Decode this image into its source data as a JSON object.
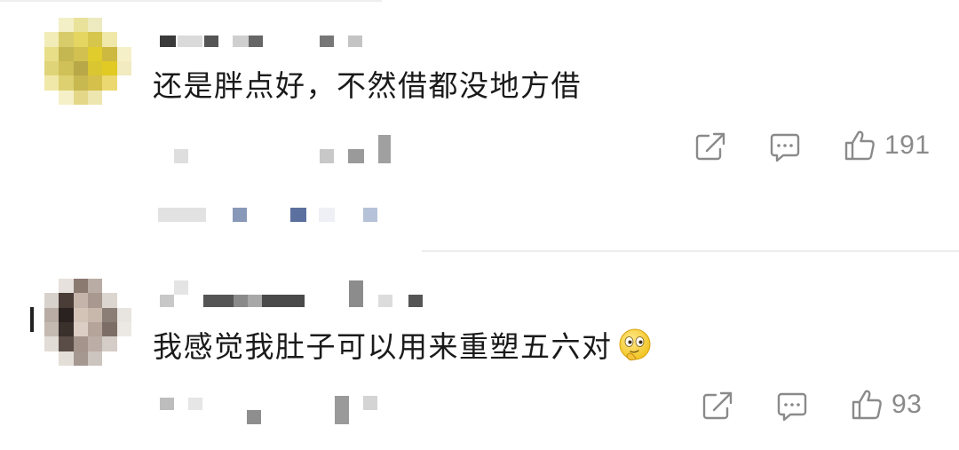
{
  "comments": [
    {
      "text": "还是胖点好，不然借都没地方借",
      "like_count": "191",
      "avatar_style": "blurred-yellow",
      "share_icon": "share-icon",
      "reply_icon": "comment-bubble-icon",
      "like_icon": "thumbs-up-icon"
    },
    {
      "text": "我感觉我肚子可以用来重塑五六对",
      "emoji": "smirk-face-emoji",
      "like_count": "93",
      "avatar_style": "blurred-portrait",
      "share_icon": "share-icon",
      "reply_icon": "comment-bubble-icon",
      "like_icon": "thumbs-up-icon"
    }
  ],
  "colors": {
    "text": "#1a1a1a",
    "icon": "#8a8a8a",
    "divider": "#ececec",
    "blurred_link": "#6e82a6"
  }
}
